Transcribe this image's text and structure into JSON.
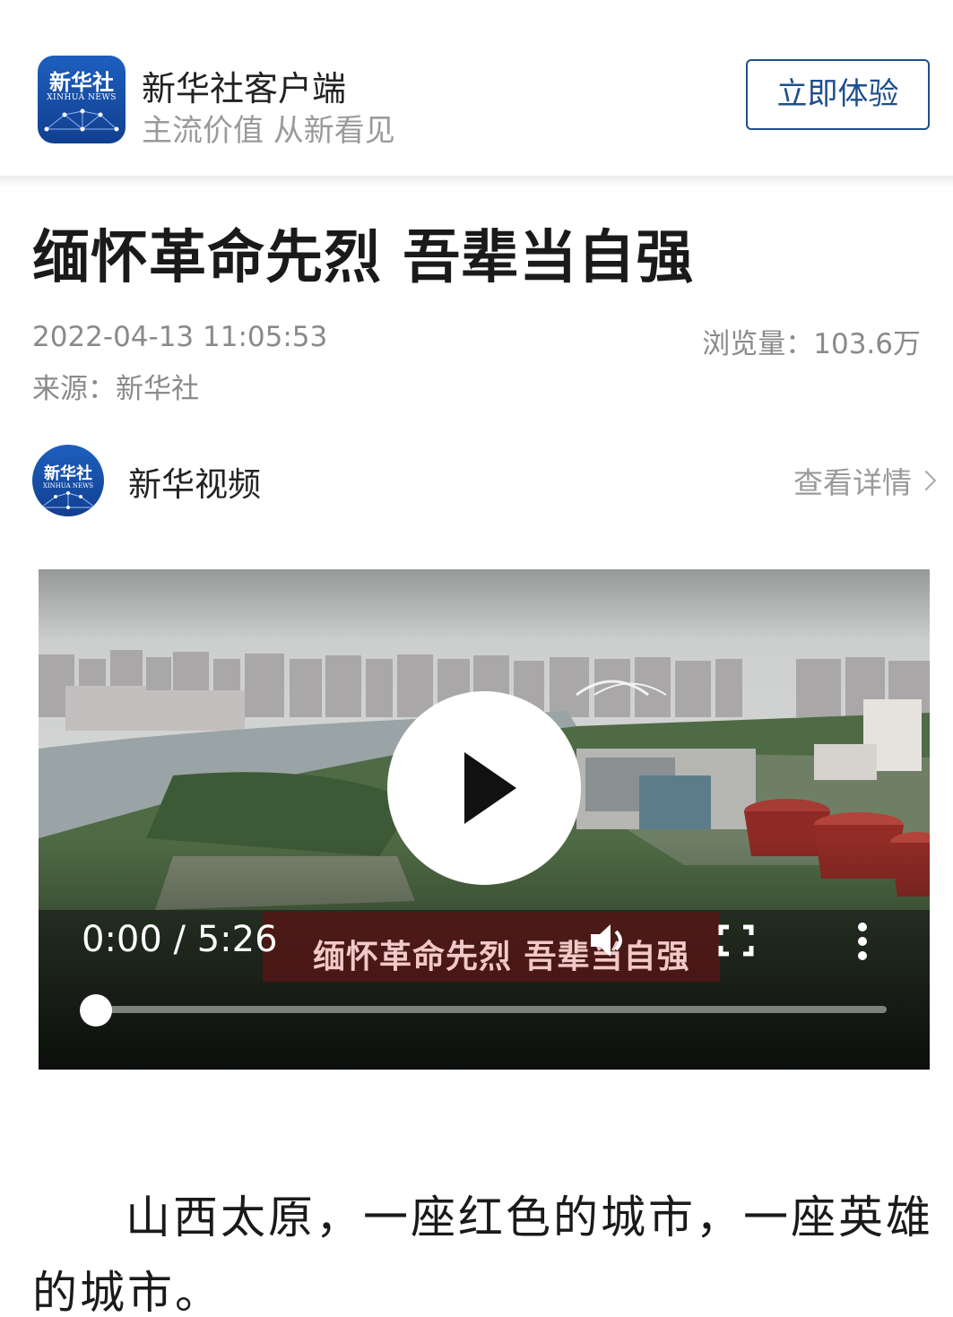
{
  "header": {
    "logo": {
      "cn": "新华社",
      "en": "XINHUA NEWS"
    },
    "app_name": "新华社客户端",
    "slogan": "主流价值 从新看见",
    "try_button": "立即体验"
  },
  "article": {
    "title": "缅怀革命先烈 吾辈当自强",
    "date": "2022-04-13 11:05:53",
    "views": "浏览量：103.6万",
    "source": "来源：新华社"
  },
  "channel": {
    "avatar": {
      "cn": "新华社",
      "en": "XINHUA NEWS"
    },
    "name": "新华视频",
    "details_link": "查看详情"
  },
  "video": {
    "time": "0:00 / 5:26",
    "subtitle": "缅怀革命先烈 吾辈当自强",
    "progress": 0.0,
    "icons": [
      "play-icon",
      "volume-icon",
      "fullscreen-icon",
      "more-vertical-icon"
    ]
  },
  "body": {
    "paragraph_1": "山西太原，一座红色的城市，一座英雄",
    "paragraph_2": "的城市。"
  },
  "colors": {
    "brand_blue": "#1f4e8c",
    "meta_gray": "#8a8a8a"
  }
}
